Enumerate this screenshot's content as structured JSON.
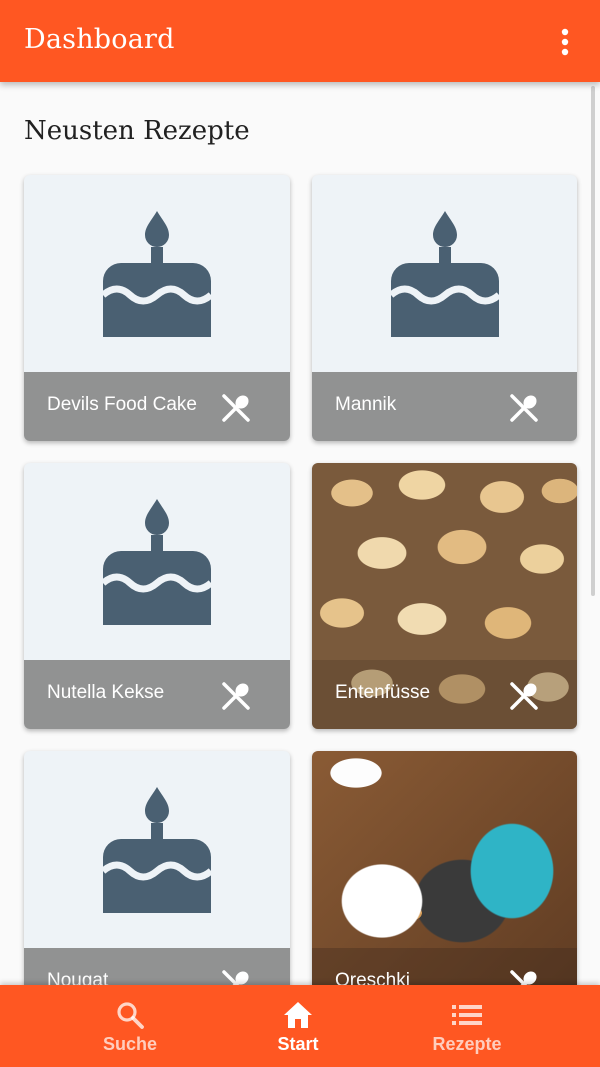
{
  "appbar": {
    "title": "Dashboard",
    "menu_icon": "more-vertical-icon"
  },
  "section": {
    "title": "Neusten Rezepte"
  },
  "recipes": [
    {
      "title": "Devils Food Cake",
      "image": "cake-placeholder-icon",
      "action_icon": "cutlery-icon"
    },
    {
      "title": "Mannik",
      "image": "cake-placeholder-icon",
      "action_icon": "cutlery-icon"
    },
    {
      "title": "Nutella Kekse",
      "image": "cake-placeholder-icon",
      "action_icon": "cutlery-icon"
    },
    {
      "title": "Entenfüsse",
      "image": "photo-cookies",
      "action_icon": "cutlery-icon"
    },
    {
      "title": "Nougat",
      "image": "cake-placeholder-icon",
      "action_icon": "cutlery-icon"
    },
    {
      "title": "Oreschki",
      "image": "photo-walnut-cookies",
      "action_icon": "cutlery-icon"
    }
  ],
  "bottom_nav": {
    "items": [
      {
        "label": "Suche",
        "icon": "search-icon",
        "active": false
      },
      {
        "label": "Start",
        "icon": "home-icon",
        "active": true
      },
      {
        "label": "Rezepte",
        "icon": "list-icon",
        "active": false
      }
    ]
  },
  "colors": {
    "primary": "#ff5722",
    "placeholder_bg": "#eef3f7",
    "placeholder_icon": "#4a6072",
    "card_bar": "#808080"
  }
}
